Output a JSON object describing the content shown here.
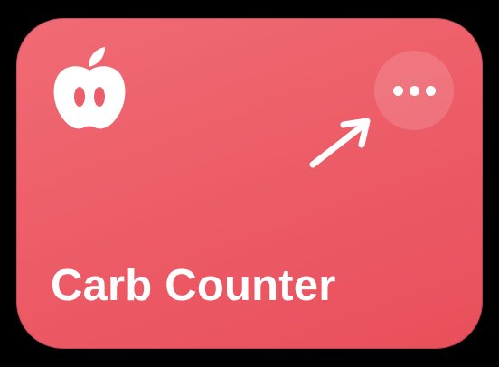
{
  "shortcut": {
    "title": "Carb Counter",
    "icon": "apple-icon",
    "more_button_icon": "ellipsis-icon",
    "annotation_icon": "arrow-icon"
  },
  "colors": {
    "background": "#000000",
    "card_gradient_start": "#f06b74",
    "card_gradient_end": "#e84f5b",
    "foreground": "#ffffff"
  }
}
